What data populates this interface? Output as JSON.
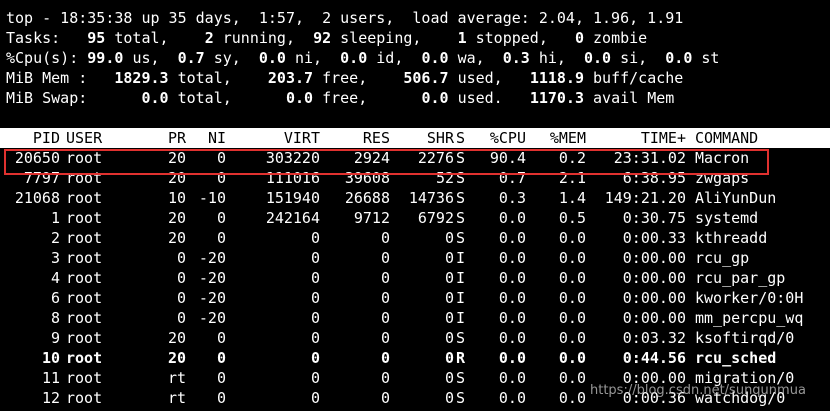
{
  "summary": {
    "line1": "top - 18:35:38 up 35 days,  1:57,  2 users,  load average: 2.04, 1.96, 1.91",
    "tasks": {
      "label": "Tasks:",
      "total": "95",
      "total_label": "total,",
      "running": "2",
      "running_label": "running,",
      "sleeping": "92",
      "sleeping_label": "sleeping,",
      "stopped": "1",
      "stopped_label": "stopped,",
      "zombie": "0",
      "zombie_label": "zombie"
    },
    "cpu": {
      "label": "%Cpu(s):",
      "us": "99.0",
      "us_label": "us,",
      "sy": "0.7",
      "sy_label": "sy,",
      "ni": "0.0",
      "ni_label": "ni,",
      "id": "0.0",
      "id_label": "id,",
      "wa": "0.0",
      "wa_label": "wa,",
      "hi": "0.3",
      "hi_label": "hi,",
      "si": "0.0",
      "si_label": "si,",
      "st": "0.0",
      "st_label": "st"
    },
    "mem": {
      "label": "MiB Mem :",
      "total": "1829.3",
      "total_label": "total,",
      "free": "203.7",
      "free_label": "free,",
      "used": "506.7",
      "used_label": "used,",
      "buff": "1118.9",
      "buff_label": "buff/cache"
    },
    "swap": {
      "label": "MiB Swap:",
      "total": "0.0",
      "total_label": "total,",
      "free": "0.0",
      "free_label": "free,",
      "used": "0.0",
      "used_label": "used.",
      "avail": "1170.3",
      "avail_label": "avail Mem"
    }
  },
  "table": {
    "headers": [
      "PID",
      "USER",
      "PR",
      "NI",
      "VIRT",
      "RES",
      "SHR",
      "S",
      "%CPU",
      "%MEM",
      "TIME+",
      "COMMAND"
    ],
    "rows": [
      [
        "20650",
        "root",
        "20",
        "0",
        "303220",
        "2924",
        "2276",
        "S",
        "90.4",
        "0.2",
        "23:31.02",
        "Macron"
      ],
      [
        "7797",
        "root",
        "20",
        "0",
        "111016",
        "39608",
        "52",
        "S",
        "0.7",
        "2.1",
        "6:38.95",
        "zwgaps"
      ],
      [
        "21068",
        "root",
        "10",
        "-10",
        "151940",
        "26688",
        "14736",
        "S",
        "0.3",
        "1.4",
        "149:21.20",
        "AliYunDun"
      ],
      [
        "1",
        "root",
        "20",
        "0",
        "242164",
        "9712",
        "6792",
        "S",
        "0.0",
        "0.5",
        "0:30.75",
        "systemd"
      ],
      [
        "2",
        "root",
        "20",
        "0",
        "0",
        "0",
        "0",
        "S",
        "0.0",
        "0.0",
        "0:00.33",
        "kthreadd"
      ],
      [
        "3",
        "root",
        "0",
        "-20",
        "0",
        "0",
        "0",
        "I",
        "0.0",
        "0.0",
        "0:00.00",
        "rcu_gp"
      ],
      [
        "4",
        "root",
        "0",
        "-20",
        "0",
        "0",
        "0",
        "I",
        "0.0",
        "0.0",
        "0:00.00",
        "rcu_par_gp"
      ],
      [
        "6",
        "root",
        "0",
        "-20",
        "0",
        "0",
        "0",
        "I",
        "0.0",
        "0.0",
        "0:00.00",
        "kworker/0:0H"
      ],
      [
        "8",
        "root",
        "0",
        "-20",
        "0",
        "0",
        "0",
        "I",
        "0.0",
        "0.0",
        "0:00.00",
        "mm_percpu_wq"
      ],
      [
        "9",
        "root",
        "20",
        "0",
        "0",
        "0",
        "0",
        "S",
        "0.0",
        "0.0",
        "0:03.32",
        "ksoftirqd/0"
      ],
      [
        "10",
        "root",
        "20",
        "0",
        "0",
        "0",
        "0",
        "R",
        "0.0",
        "0.0",
        "0:44.56",
        "rcu_sched"
      ],
      [
        "11",
        "root",
        "rt",
        "0",
        "0",
        "0",
        "0",
        "S",
        "0.0",
        "0.0",
        "0:00.00",
        "migration/0"
      ],
      [
        "12",
        "root",
        "rt",
        "0",
        "0",
        "0",
        "0",
        "S",
        "0.0",
        "0.0",
        "0:00.36",
        "watchdog/0"
      ]
    ],
    "bold_row_index": 10,
    "highlighted_row_index": 0
  },
  "colors": {
    "background": "#000000",
    "text": "#ffffff",
    "header_bg": "#ffffff",
    "header_text": "#000000",
    "highlight_box": "#e0312f"
  },
  "watermark": "https://blog.csdn.net/sunqunmua"
}
